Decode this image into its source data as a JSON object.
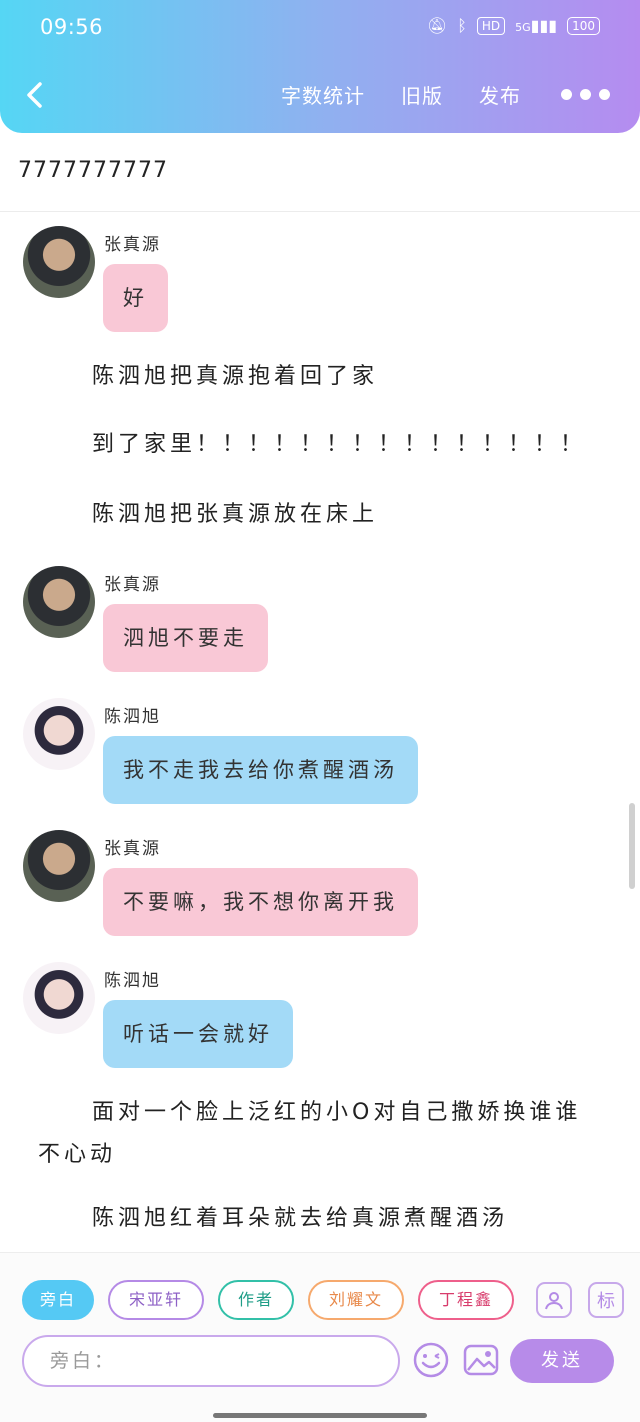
{
  "status_bar": {
    "time": "09:56",
    "hd_label": "HD",
    "signal_label": "5G",
    "battery": "100"
  },
  "nav": {
    "word_count": "字数统计",
    "old_version": "旧版",
    "publish": "发布"
  },
  "title": "7777777777",
  "messages": [
    {
      "sender": "张真源",
      "text": "好",
      "color": "#f9c8d6"
    },
    {
      "narration": "陈泗旭把真源抱着回了家"
    },
    {
      "narration": "到了家里！！！！！！！！！！！！！！！"
    },
    {
      "narration": "陈泗旭把张真源放在床上"
    },
    {
      "sender": "张真源",
      "text": "泗旭不要走",
      "color": "#f9c8d6"
    },
    {
      "sender": "陈泗旭",
      "text": "我不走我去给你煮醒酒汤",
      "color": "#a3daf7"
    },
    {
      "sender": "张真源",
      "text": "不要嘛，我不想你离开我",
      "color": "#f9c8d6"
    },
    {
      "sender": "陈泗旭",
      "text": "听话一会就好",
      "color": "#a3daf7"
    },
    {
      "narration": "面对一个脸上泛红的小O对自己撒娇换谁谁不心动"
    },
    {
      "narration": "陈泗旭红着耳朵就去给真源煮醒酒汤"
    }
  ],
  "roles": [
    {
      "label": "旁白",
      "active": true
    },
    {
      "label": "宋亚轩",
      "active": false
    },
    {
      "label": "作者",
      "active": false
    },
    {
      "label": "刘耀文",
      "active": false
    },
    {
      "label": "丁程鑫",
      "active": false
    }
  ],
  "mark_label": "标",
  "input": {
    "placeholder": "旁白："
  },
  "send_label": "发送",
  "icons": [
    "back-arrow-icon",
    "more-dots-icon",
    "contact-icon",
    "emoji-icon",
    "image-icon"
  ]
}
